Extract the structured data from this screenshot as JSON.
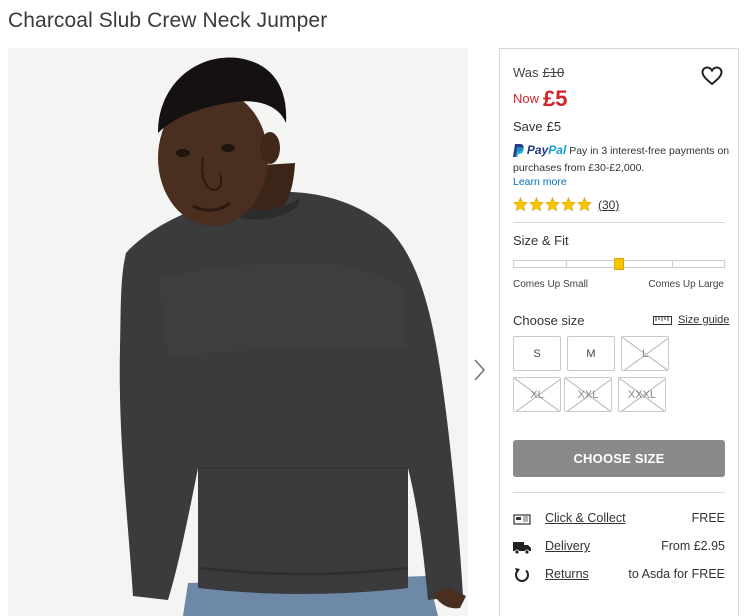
{
  "product": {
    "title": "Charcoal Slub Crew Neck Jumper"
  },
  "price": {
    "was_label": "Was",
    "was_value": "£10",
    "now_label": "Now",
    "now_value": "£5",
    "save_label": "Save",
    "save_value": "£5"
  },
  "paypal": {
    "brand_pay": "Pay",
    "brand_pal": "Pal",
    "text": "Pay in 3 interest-free payments on purchases from £30-£2,000.",
    "learn_more": "Learn more"
  },
  "rating": {
    "stars": 5,
    "count": "(30)"
  },
  "fit": {
    "label": "Size & Fit",
    "left": "Comes Up Small",
    "right": "Comes Up Large",
    "position_fraction": 0.5
  },
  "size": {
    "label": "Choose size",
    "guide": "Size guide",
    "options": [
      {
        "label": "S",
        "available": true
      },
      {
        "label": "M",
        "available": true
      },
      {
        "label": "L",
        "available": false
      },
      {
        "label": "XL",
        "available": false
      },
      {
        "label": "XXL",
        "available": false
      },
      {
        "label": "XXXL",
        "available": false
      }
    ]
  },
  "cta": {
    "choose_size": "CHOOSE SIZE"
  },
  "delivery": [
    {
      "icon": "store-icon",
      "link": "Click & Collect",
      "value": "FREE"
    },
    {
      "icon": "truck-icon",
      "link": "Delivery",
      "value": "From £2.95"
    },
    {
      "icon": "return-icon",
      "link": "Returns",
      "value": "to Asda for FREE"
    }
  ],
  "colors": {
    "price_now": "#d3222a",
    "star": "#f7c400",
    "cta_bg": "#8a8a8a",
    "paypal_dark": "#253b80",
    "paypal_light": "#179bd7"
  }
}
